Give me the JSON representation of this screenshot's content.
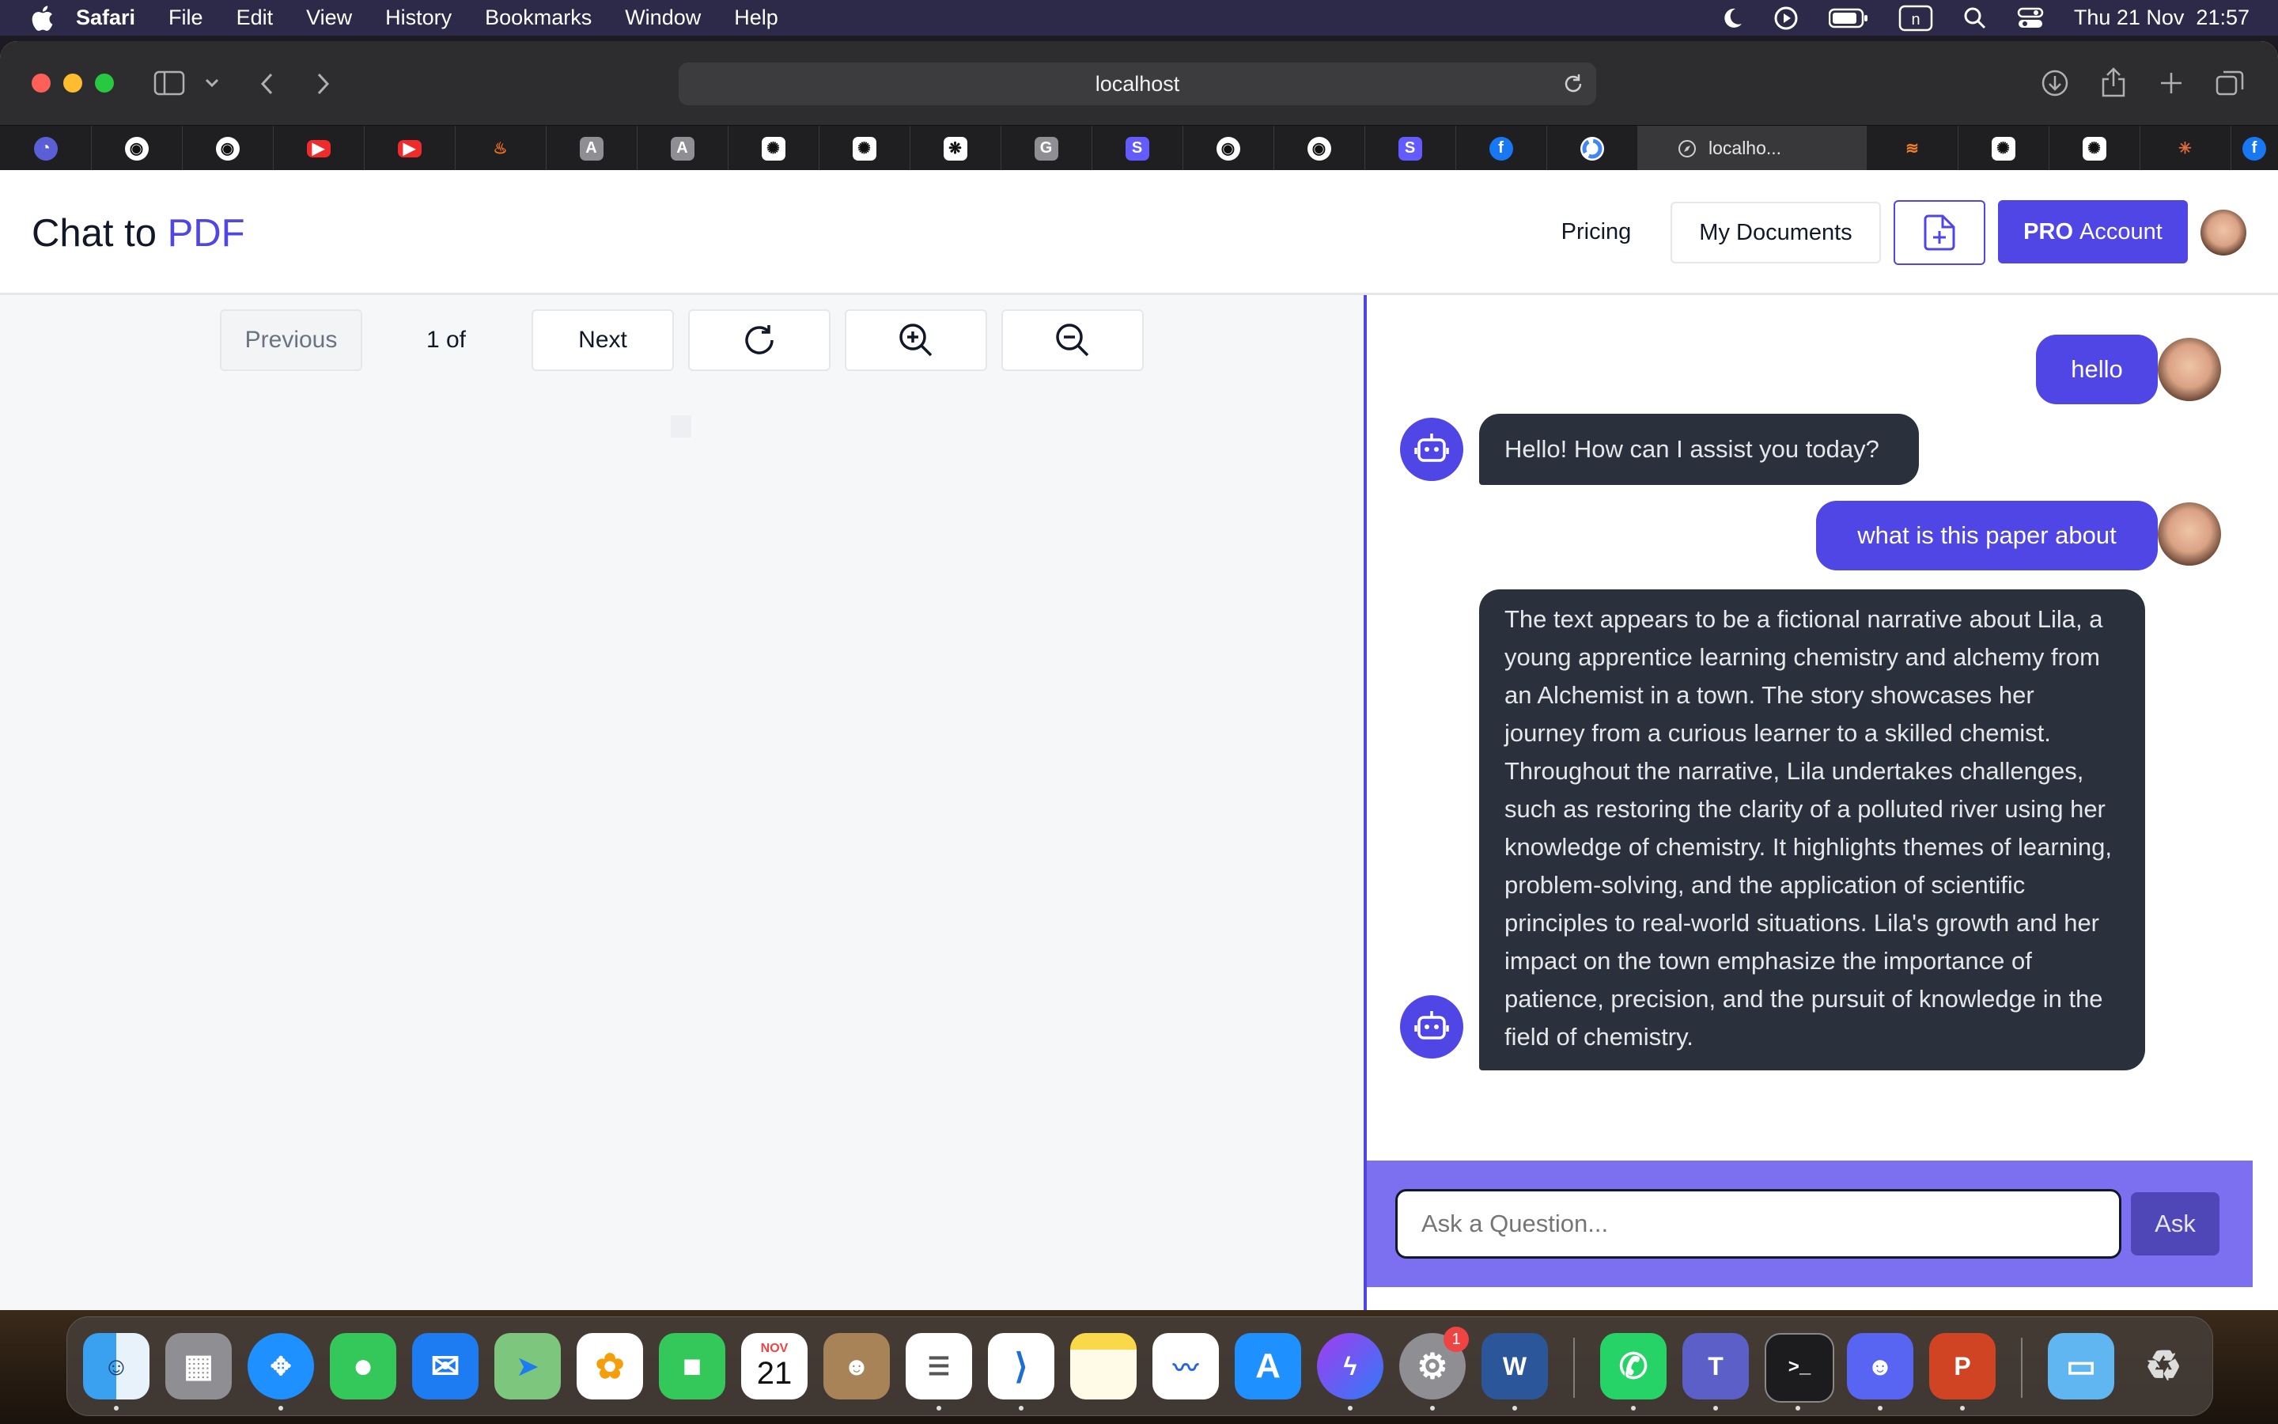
{
  "menubar": {
    "app_name": "Safari",
    "items": [
      "File",
      "Edit",
      "View",
      "History",
      "Bookmarks",
      "Window",
      "Help"
    ],
    "clock": "Thu 21 Nov  21:57",
    "status_icons": [
      "moon-icon",
      "play-circle-icon",
      "battery-icon",
      "n-app-icon",
      "search-icon",
      "control-center-icon"
    ]
  },
  "browser": {
    "url": "localhost",
    "active_tab_title": "localho...",
    "tab_favicons": [
      "shield-icon",
      "github-icon",
      "github-icon",
      "youtube-icon",
      "youtube-icon",
      "fire-icon",
      "a-icon",
      "a-icon",
      "openai-icon",
      "openai-icon",
      "dots-icon",
      "g-icon",
      "s-icon",
      "github-icon",
      "github-icon",
      "s-icon",
      "facebook-icon",
      "google-icon",
      "compass-icon",
      "stack-icon",
      "openai-icon",
      "openai-icon",
      "star-icon",
      "facebook-icon"
    ],
    "favicon_letters": {
      "a": "A",
      "g": "G",
      "s": "S",
      "facebook": "f"
    }
  },
  "header": {
    "brand_prefix": "Chat to ",
    "brand_accent": "PDF",
    "pricing": "Pricing",
    "my_documents": "My Documents",
    "pro_account": "PRO Account",
    "accent_color": "#4f46e5"
  },
  "pdf_viewer": {
    "previous": "Previous",
    "page_indicator": "1 of",
    "next": "Next"
  },
  "chat": {
    "messages": [
      {
        "role": "user",
        "text": "hello"
      },
      {
        "role": "bot",
        "text": "Hello! How can I assist you today?"
      },
      {
        "role": "user",
        "text": "what is this paper about"
      },
      {
        "role": "bot",
        "text": "The text appears to be a fictional narrative about Lila, a young apprentice learning chemistry and alchemy from an Alchemist in a town. The story showcases her journey from a curious learner to a skilled chemist. Throughout the narrative, Lila undertakes challenges, such as restoring the clarity of a polluted river using her knowledge of chemistry. It highlights themes of learning, problem-solving, and the application of scientific principles to real-world situations. Lila's growth and her impact on the town emphasize the importance of patience, precision, and the pursuit of knowledge in the field of chemistry."
      }
    ],
    "input_placeholder": "Ask a Question...",
    "ask_button": "Ask"
  },
  "dock": {
    "apps": [
      "Finder",
      "Launchpad",
      "Safari",
      "Messages",
      "Mail",
      "Maps",
      "Photos",
      "FaceTime",
      "Calendar",
      "Contacts",
      "Reminders",
      "VS Code",
      "Notes",
      "Freeform",
      "App Store",
      "Messenger",
      "System Settings",
      "Word",
      "WhatsApp",
      "Teams",
      "Terminal",
      "Discord",
      "PowerPoint",
      "Folder",
      "Trash"
    ],
    "calendar_month": "NOV",
    "calendar_day": "21",
    "settings_badge": "1",
    "word_letter": "W",
    "powerpoint_letter": "P"
  }
}
